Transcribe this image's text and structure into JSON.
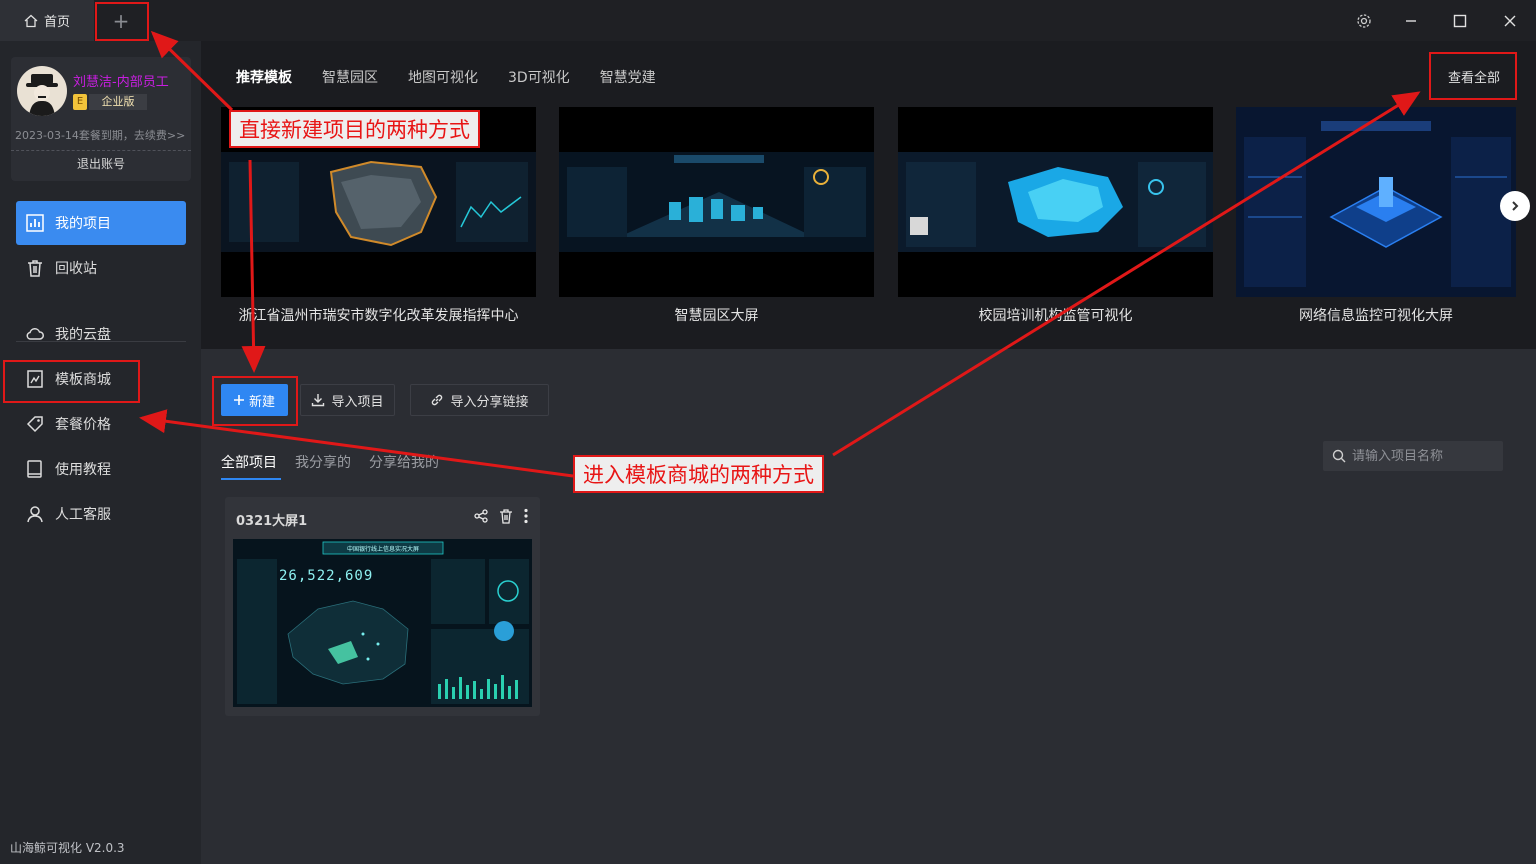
{
  "titlebar": {
    "home_tab": "首页",
    "add_tab": "+",
    "icons": [
      "home-icon",
      "gear-icon",
      "minimize-icon",
      "maximize-icon",
      "close-icon"
    ]
  },
  "user": {
    "name": "刘慧洁-内部员工",
    "tier_badge": "E",
    "tier_label": "企业版",
    "expire_text": "2023-03-14套餐到期，去续费>>",
    "logout_label": "退出账号"
  },
  "sidebar": {
    "items": [
      {
        "label": "我的项目",
        "icon": "chart-icon",
        "active": true
      },
      {
        "label": "回收站",
        "icon": "trash-icon"
      },
      {
        "label": "我的云盘",
        "icon": "cloud-icon"
      },
      {
        "label": "模板商城",
        "icon": "store-icon"
      },
      {
        "label": "套餐价格",
        "icon": "tag-icon"
      },
      {
        "label": "使用教程",
        "icon": "book-icon"
      },
      {
        "label": "人工客服",
        "icon": "user-icon"
      }
    ],
    "version": "山海鲸可视化 V2.0.3"
  },
  "templates": {
    "tabs": [
      "推荐模板",
      "智慧园区",
      "地图可视化",
      "3D可视化",
      "智慧党建"
    ],
    "see_all": "查看全部",
    "cards": [
      {
        "caption": "浙江省温州市瑞安市数字化改革发展指挥中心"
      },
      {
        "caption": "智慧园区大屏"
      },
      {
        "caption": "校园培训机构监管可视化"
      },
      {
        "caption": "网络信息监控可视化大屏"
      }
    ]
  },
  "actions": {
    "new_label": "新建",
    "import_label": "导入项目",
    "import_link_label": "导入分享链接"
  },
  "projects": {
    "tabs": [
      "全部项目",
      "我分享的",
      "分享给我的"
    ],
    "search_placeholder": "请输入项目名称",
    "items": [
      {
        "name": "0321大屏1",
        "thumb_title": "中国银行线上信息实况大屏",
        "thumb_number": "26,522,609"
      }
    ]
  },
  "annotations": {
    "new_methods": "直接新建项目的两种方式",
    "store_methods": "进入模板商城的两种方式"
  },
  "colors": {
    "accent": "#2f87f3",
    "annotation": "#e01818",
    "username": "#c81ee0"
  }
}
